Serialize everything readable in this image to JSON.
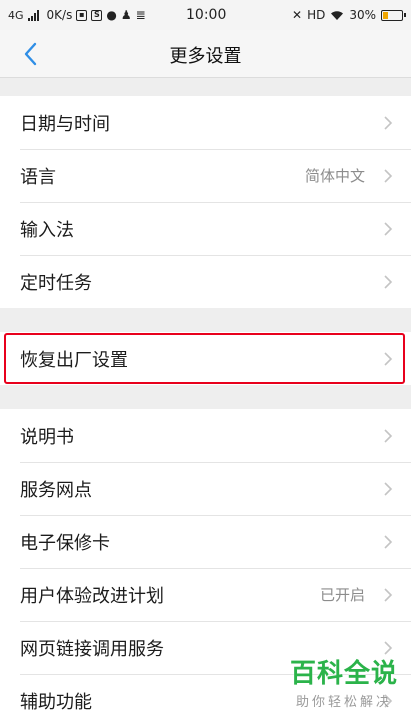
{
  "status_bar": {
    "network_type": "4G",
    "speed": "0K/s",
    "time": "10:00",
    "hd_label": "HD",
    "battery_percent": "30%",
    "battery_level": 0.3,
    "icons": [
      "signal-icon",
      "data-saver-icon",
      "sync-icon",
      "chat-icon",
      "notification-icon",
      "storage-icon",
      "mute-icon",
      "wifi-icon",
      "battery-icon"
    ]
  },
  "nav": {
    "title": "更多设置",
    "back_icon": "chevron-left-icon"
  },
  "groups": [
    {
      "items": [
        {
          "label": "日期与时间",
          "value": ""
        },
        {
          "label": "语言",
          "value": "简体中文"
        },
        {
          "label": "输入法",
          "value": ""
        },
        {
          "label": "定时任务",
          "value": ""
        }
      ]
    },
    {
      "items": [
        {
          "label": "恢复出厂设置",
          "value": ""
        }
      ]
    },
    {
      "items": [
        {
          "label": "说明书",
          "value": ""
        },
        {
          "label": "服务网点",
          "value": ""
        },
        {
          "label": "电子保修卡",
          "value": ""
        },
        {
          "label": "用户体验改进计划",
          "value": "已开启"
        },
        {
          "label": "网页链接调用服务",
          "value": ""
        },
        {
          "label": "辅助功能",
          "value": ""
        }
      ]
    }
  ],
  "watermark": {
    "title": "百科全说",
    "subtitle": "助你轻松解决"
  },
  "colors": {
    "highlight": "#e8001c",
    "back_arrow": "#2f8ee6",
    "watermark": "#2bb34a"
  }
}
